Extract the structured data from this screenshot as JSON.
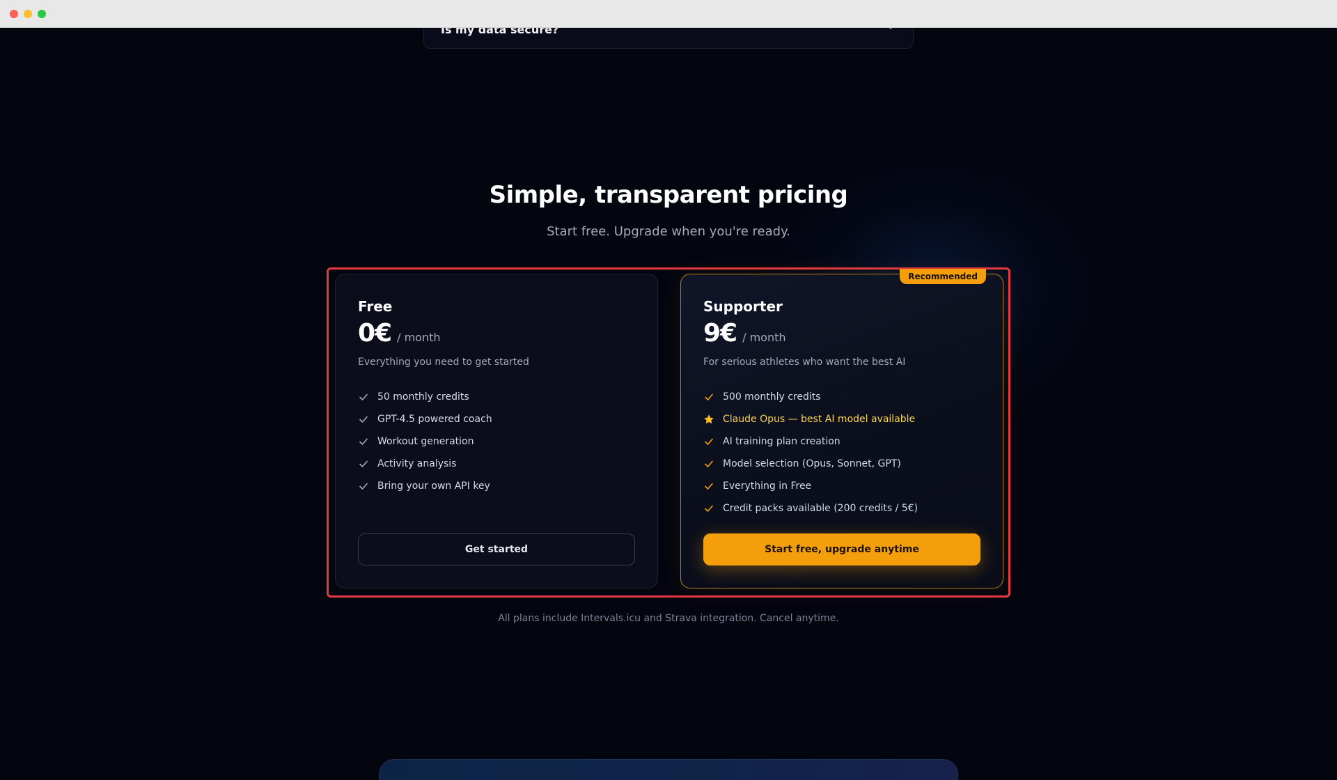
{
  "faq": {
    "question": "Is my data secure?"
  },
  "pricing": {
    "title": "Simple, transparent pricing",
    "subtitle": "Start free. Upgrade when you're ready.",
    "plans": [
      {
        "name": "Free",
        "price": "0€",
        "period": "/ month",
        "description": "Everything you need to get started",
        "features": [
          {
            "text": "50 monthly credits",
            "icon": "check-icon"
          },
          {
            "text": "GPT-4.5 powered coach",
            "icon": "check-icon"
          },
          {
            "text": "Workout generation",
            "icon": "check-icon"
          },
          {
            "text": "Activity analysis",
            "icon": "check-icon"
          },
          {
            "text": "Bring your own API key",
            "icon": "check-icon"
          }
        ],
        "cta": "Get started"
      },
      {
        "name": "Supporter",
        "badge": "Recommended",
        "price": "9€",
        "period": "/ month",
        "description": "For serious athletes who want the best AI",
        "features": [
          {
            "text": "500 monthly credits",
            "icon": "check-icon"
          },
          {
            "text": "Claude Opus — best AI model available",
            "icon": "star-icon"
          },
          {
            "text": "AI training plan creation",
            "icon": "check-icon"
          },
          {
            "text": "Model selection (Opus, Sonnet, GPT)",
            "icon": "check-icon"
          },
          {
            "text": "Everything in Free",
            "icon": "check-icon"
          },
          {
            "text": "Credit packs available (200 credits / 5€)",
            "icon": "check-icon"
          }
        ],
        "cta": "Start free, upgrade anytime"
      }
    ],
    "footnote": "All plans include Intervals.icu and Strava integration. Cancel anytime."
  },
  "colors": {
    "background": "#03050f",
    "accent": "#f59e0b",
    "highlight_outline": "#e5393f",
    "free_check": "#a4aabb",
    "supporter_check": "#f59e0b"
  }
}
